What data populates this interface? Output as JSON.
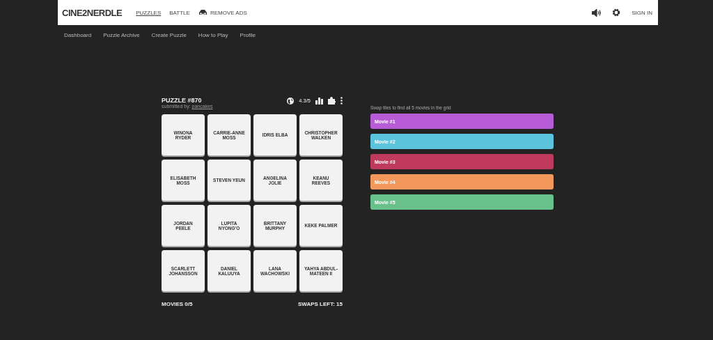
{
  "header": {
    "logo": "CINE2NERDLE",
    "nav": [
      {
        "label": "PUZZLES",
        "selected": true
      },
      {
        "label": "BATTLE",
        "selected": false
      },
      {
        "label": "REMOVE ADS",
        "selected": false,
        "kind": "glasses"
      }
    ],
    "sign_in": "SIGN IN"
  },
  "subnav": [
    "Dashboard",
    "Puzzle Archive",
    "Create Puzzle",
    "How to Play",
    "Profile"
  ],
  "puzzle": {
    "title": "PUZZLE #870",
    "submitted_label": "submitted by:",
    "submitted_by": "pancakes",
    "rating": "4.3/5",
    "tiles": [
      "WINONA RYDER",
      "CARRIE-ANNE MOSS",
      "IDRIS ELBA",
      "CHRISTOPHER WALKEN",
      "ELISABETH MOSS",
      "STEVEN YEUN",
      "ANGELINA JOLIE",
      "KEANU REEVES",
      "JORDAN PEELE",
      "LUPITA NYONG'O",
      "BRITTANY MURPHY",
      "KEKE PALMER",
      "SCARLETT JOHANSSON",
      "DANIEL KALUUYA",
      "LANA WACHOWSKI",
      "YAHYA ABDUL-MATEEN II"
    ],
    "movies_count": "MOVIES 0/5",
    "swaps_left": "SWAPS LEFT: 15"
  },
  "instructions": "Swap tiles to find all 5 movies in the grid",
  "movies": [
    {
      "label": "Movie #1",
      "color": "#b85bd6"
    },
    {
      "label": "Movie #2",
      "color": "#5bc3dc"
    },
    {
      "label": "Movie #3",
      "color": "#c03a5e"
    },
    {
      "label": "Movie #4",
      "color": "#f1985a"
    },
    {
      "label": "Movie #5",
      "color": "#68c08a"
    }
  ]
}
